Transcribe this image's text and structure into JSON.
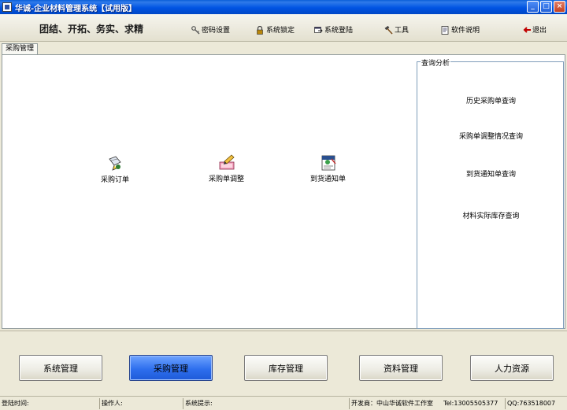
{
  "window": {
    "title": "华诚-企业材料管理系统【试用版】",
    "controls": [
      "_",
      "□",
      "×"
    ]
  },
  "toolbar": {
    "slogan": "团结、开拓、务实、求精",
    "items": [
      {
        "label": "密码设置",
        "icon": "key-icon"
      },
      {
        "label": "系统锁定",
        "icon": "lock-icon"
      },
      {
        "label": "系统登陆",
        "icon": "login-icon"
      },
      {
        "label": "工具",
        "icon": "hammer-icon"
      },
      {
        "label": "软件说明",
        "icon": "document-icon"
      },
      {
        "label": "退出",
        "icon": "exit-arrow-icon"
      }
    ]
  },
  "tabs": [
    {
      "label": "采购管理"
    }
  ],
  "modules": [
    {
      "label": "采购订单",
      "icon": "purchase-order-icon"
    },
    {
      "label": "采购单调整",
      "icon": "adjust-order-icon"
    },
    {
      "label": "到货通知单",
      "icon": "arrival-notice-icon"
    }
  ],
  "query": {
    "title": "查询分析",
    "links": [
      "历史采购单查询",
      "采购单调整情况查询",
      "到货通知单查询",
      "材料实际库存查询"
    ]
  },
  "nav_buttons": [
    {
      "label": "系统管理",
      "active": false
    },
    {
      "label": "采购管理",
      "active": true
    },
    {
      "label": "库存管理",
      "active": false
    },
    {
      "label": "资料管理",
      "active": false
    },
    {
      "label": "人力资源",
      "active": false
    }
  ],
  "status": {
    "login_time": "登陆时间:",
    "operator": "操作人:",
    "hint": "系统提示:",
    "developer": "开发商：中山华诚软件工作室",
    "tel": "Tel:13005505377",
    "qq": "QQ:763518007"
  },
  "colors": {
    "titlebar": "#0054e3",
    "active_button": "#2e6fee",
    "panel_bg": "#ece9d8"
  }
}
